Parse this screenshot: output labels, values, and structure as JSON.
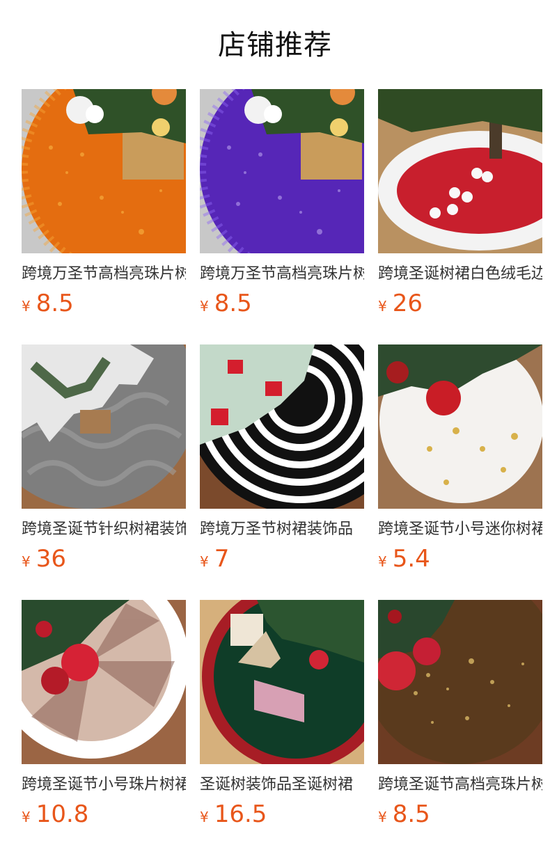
{
  "page": {
    "title": "店铺推荐"
  },
  "products": [
    {
      "name": "跨境万圣节高档亮珠片树裙",
      "currency": "¥",
      "price": "8.5",
      "icon": "orange-sequin-tree-skirt"
    },
    {
      "name": "跨境万圣节高档亮珠片树裙",
      "currency": "¥",
      "price": "8.5",
      "icon": "purple-sequin-tree-skirt"
    },
    {
      "name": "跨境圣诞树裙白色绒毛边",
      "currency": "¥",
      "price": "26",
      "icon": "red-white-plush-tree-skirt"
    },
    {
      "name": "跨境圣诞节针织树裙装饰",
      "currency": "¥",
      "price": "36",
      "icon": "grey-knit-tree-skirt"
    },
    {
      "name": "跨境万圣节树裙装饰品",
      "currency": "¥",
      "price": "7",
      "icon": "black-white-stripe-tree-skirt"
    },
    {
      "name": "跨境圣诞节小号迷你树裙",
      "currency": "¥",
      "price": "5.4",
      "icon": "white-snowflake-tree-skirt"
    },
    {
      "name": "跨境圣诞节小号珠片树裙",
      "currency": "¥",
      "price": "10.8",
      "icon": "rosegold-sequin-tree-skirt"
    },
    {
      "name": "圣诞树装饰品圣诞树裙",
      "currency": "¥",
      "price": "16.5",
      "icon": "green-red-elf-tree-skirt"
    },
    {
      "name": "跨境圣诞节高档亮珠片树裙",
      "currency": "¥",
      "price": "8.5",
      "icon": "gold-sequin-tree-skirt"
    }
  ],
  "colors": {
    "price": "#e8561a",
    "title": "#111111",
    "name": "#333333"
  }
}
